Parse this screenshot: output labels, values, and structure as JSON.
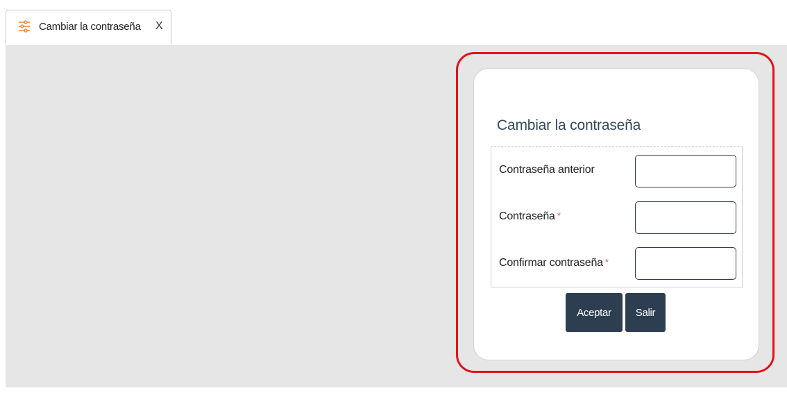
{
  "tab": {
    "icon": "sliders-icon",
    "label": "Cambiar la contraseña",
    "close_label": "X"
  },
  "dialog": {
    "title": "Cambiar la contraseña",
    "fields": [
      {
        "label": "Contraseña anterior",
        "required": false,
        "value": ""
      },
      {
        "label": "Contraseña",
        "required": true,
        "required_mark": "*",
        "value": ""
      },
      {
        "label": "Confirmar contraseña",
        "required": true,
        "required_mark": "*",
        "value": ""
      }
    ],
    "buttons": {
      "accept_label": "Aceptar",
      "exit_label": "Salir"
    }
  },
  "colors": {
    "accent_dark": "#2c3e50",
    "title_color": "#34495e",
    "highlight_red": "#e3121b",
    "icon_orange": "#f0883a",
    "required_red": "#d9534f",
    "workspace_bg": "#e6e6e6"
  }
}
